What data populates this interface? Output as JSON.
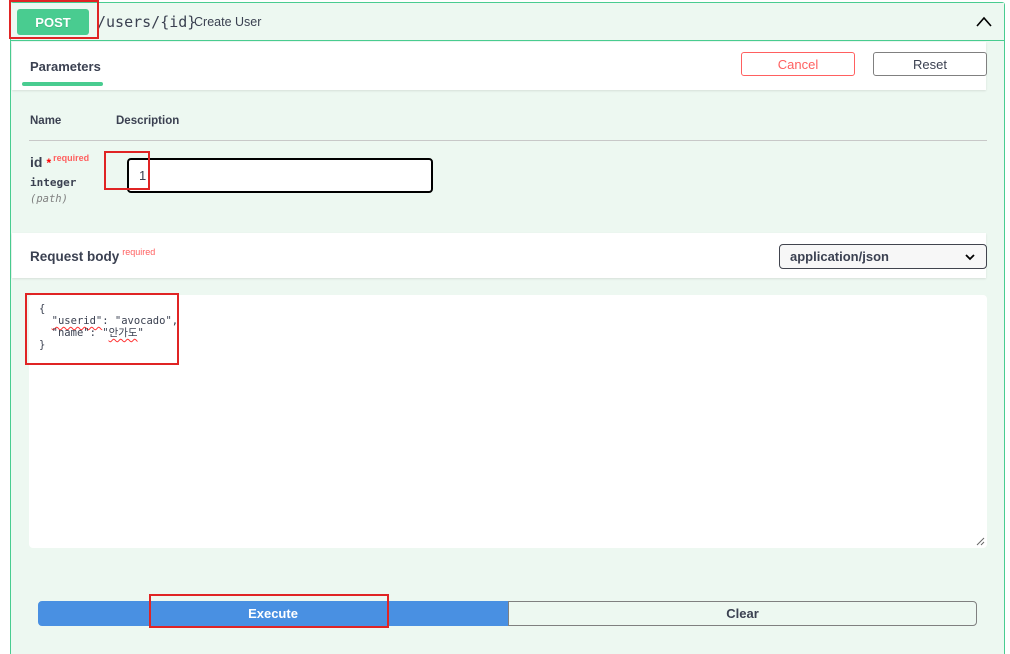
{
  "operation": {
    "method": "POST",
    "path": "/users/{id}",
    "summary": "Create User"
  },
  "tabs": {
    "parameters_label": "Parameters",
    "cancel_label": "Cancel",
    "reset_label": "Reset"
  },
  "parameters_table": {
    "header_name": "Name",
    "header_description": "Description",
    "param": {
      "name": "id",
      "required_star": "*",
      "required_label": "required",
      "type": "integer",
      "location": "(path)",
      "value": "1"
    }
  },
  "request_body": {
    "title": "Request body",
    "required_label": "required",
    "content_type": "application/json",
    "line1": "{",
    "line2_key": "\"userid\"",
    "line2_rest": ": \"avocado\",",
    "line3_key": "\"name\"",
    "line3_sep": ": \"",
    "line3_value": "안가도",
    "line3_end": "\"",
    "line4": "}"
  },
  "actions": {
    "execute_label": "Execute",
    "clear_label": "Clear"
  },
  "colors": {
    "post_green": "#49cc90",
    "panel_bg": "#edf8f1",
    "execute_blue": "#4990e2",
    "cancel_red": "#ff6060",
    "highlight_red": "#e02424"
  },
  "icons": {
    "collapse": "chevron-up-icon",
    "select": "chevron-down-icon",
    "resize": "resize-handle-icon"
  }
}
